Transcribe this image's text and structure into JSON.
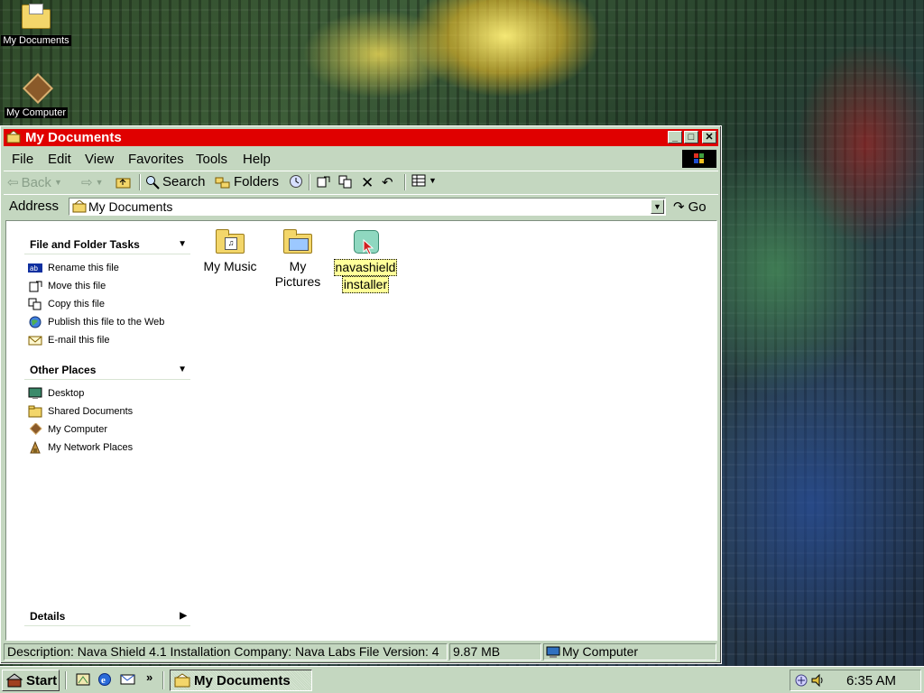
{
  "desktop": {
    "icons": [
      {
        "label": "My Documents"
      },
      {
        "label": "My Computer"
      }
    ]
  },
  "window": {
    "title": "My Documents",
    "menu": [
      "File",
      "Edit",
      "View",
      "Favorites",
      "Tools",
      "Help"
    ],
    "toolbar": {
      "back": "Back",
      "search": "Search",
      "folders": "Folders"
    },
    "address": {
      "label": "Address",
      "value": "My Documents",
      "go": "Go"
    },
    "panels": {
      "file_tasks": {
        "title": "File and Folder Tasks",
        "items": [
          "Rename this file",
          "Move this file",
          "Copy this file",
          "Publish this file to the Web",
          "E-mail this file"
        ]
      },
      "other_places": {
        "title": "Other Places",
        "items": [
          "Desktop",
          "Shared Documents",
          "My Computer",
          "My Network Places"
        ]
      },
      "details": {
        "title": "Details"
      }
    },
    "files": [
      {
        "label_line1": "My Music",
        "label_line2": ""
      },
      {
        "label_line1": "My",
        "label_line2": "Pictures"
      },
      {
        "label_line1": "navashield",
        "label_line2": "installer",
        "selected": true
      }
    ],
    "status": {
      "description": "Description: Nava Shield 4.1 Installation Company: Nava Labs File Version: 4",
      "size": "9.87 MB",
      "zone": "My Computer"
    }
  },
  "taskbar": {
    "start": "Start",
    "active_task": "My Documents",
    "chevron": "»",
    "clock": "6:35 AM"
  },
  "colors": {
    "title_active": "#e00000",
    "chrome": "#c4d7c0",
    "selection": "#ffff99"
  }
}
